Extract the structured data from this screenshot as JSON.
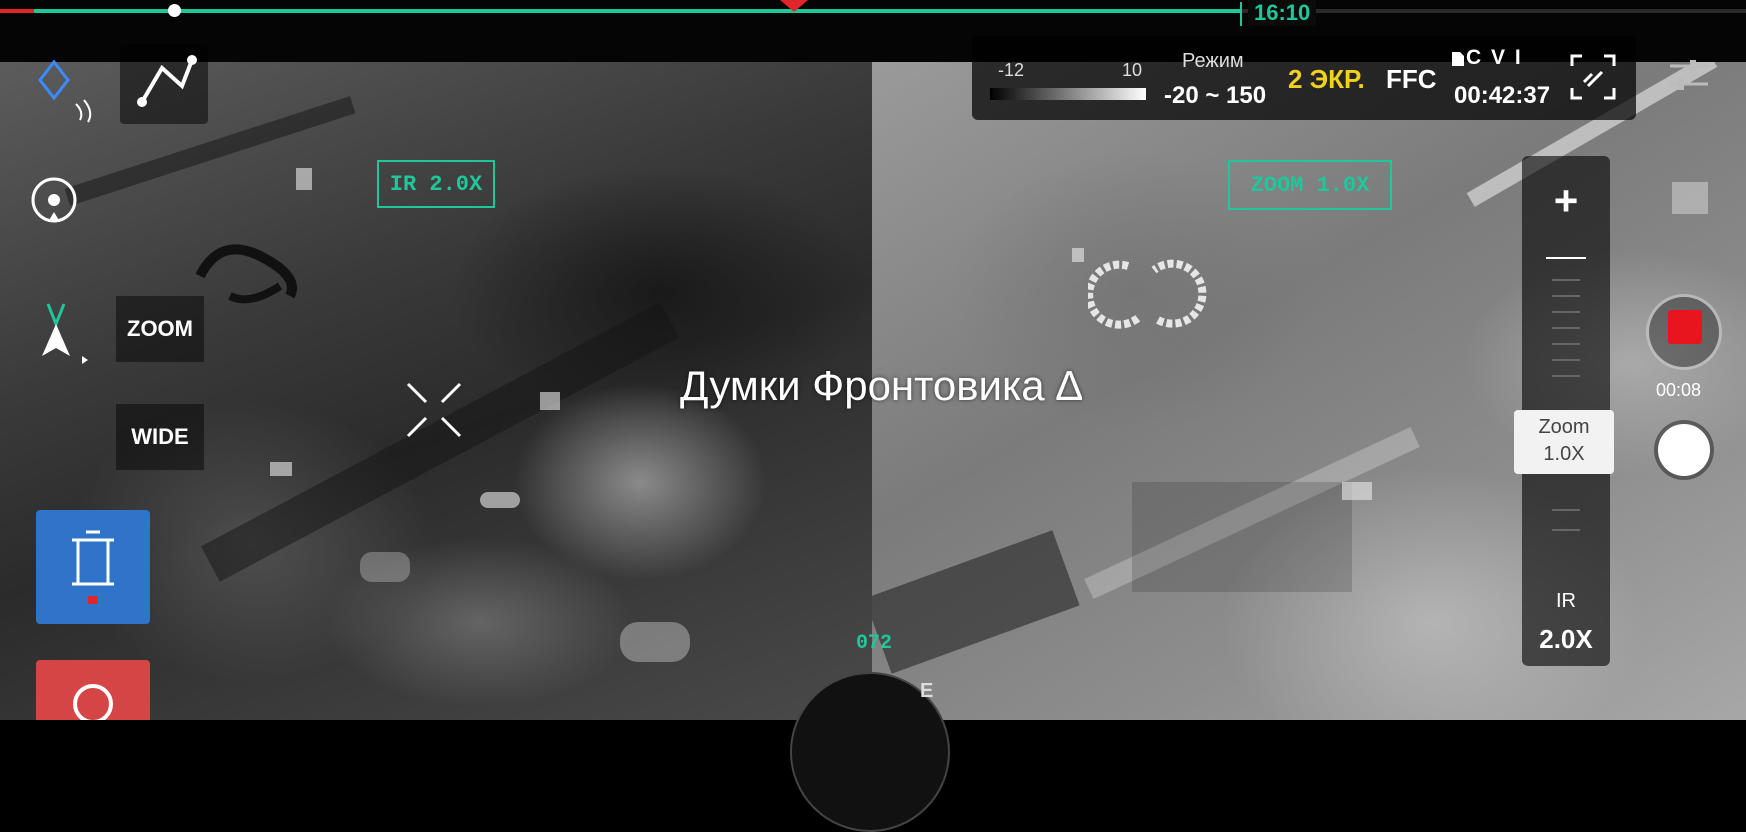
{
  "timeline": {
    "time": "16:10"
  },
  "ir_view": {
    "zoom_box": "IR 2.0X"
  },
  "zoom_view": {
    "zoom_box": "ZOOM 1.0X"
  },
  "left_controls": {
    "zoom_label": "ZOOM",
    "wide_label": "WIDE"
  },
  "status": {
    "palette_min": "-12",
    "palette_max": "10",
    "mode_label": "Режим",
    "mode_range": "-20 ~ 150",
    "screens": "2 ЭКР.",
    "ffc": "FFC",
    "storage": "C V I",
    "rec_time": "00:42:37"
  },
  "zoom_column": {
    "plus": "+",
    "current_label": "Zoom",
    "current_value": "1.0X",
    "ir_label": "IR",
    "ir_value": "2.0X"
  },
  "record": {
    "elapsed": "00:08"
  },
  "watermark": "Думки Фронтовика ∆",
  "heading": "072",
  "compass_label": "E",
  "colors": {
    "accent": "#1fc79a",
    "record": "#e8151c",
    "screens": "#f0d21c"
  }
}
